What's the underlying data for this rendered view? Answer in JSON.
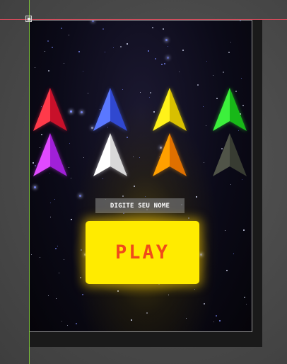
{
  "menu": {
    "name_prompt": "DIGITE SEU NOME",
    "play_label": "PLAY"
  },
  "ships": [
    {
      "name": "red-ship",
      "color": "#ff3a4a",
      "shade": "#c8102a",
      "glow": "#ff2040"
    },
    {
      "name": "blue-ship",
      "color": "#5a78ff",
      "shade": "#3048d0",
      "glow": "#4a66ff"
    },
    {
      "name": "yellow-ship",
      "color": "#fff21a",
      "shade": "#d8c000",
      "glow": "#fff000"
    },
    {
      "name": "green-ship",
      "color": "#3cf03c",
      "shade": "#18b818",
      "glow": "#30ff30"
    },
    {
      "name": "magenta-ship",
      "color": "#e04aff",
      "shade": "#a020d8",
      "glow": "#d030ff"
    },
    {
      "name": "white-ship",
      "color": "#ffffff",
      "shade": "#d8d8d8",
      "glow": "#ffffff"
    },
    {
      "name": "orange-ship",
      "color": "#ffa000",
      "shade": "#e07000",
      "glow": "#ff9000"
    },
    {
      "name": "dark-gray-ship",
      "color": "#505448",
      "shade": "#383c32",
      "glow": "#000000"
    }
  ],
  "colors": {
    "play_button": "#ffeb00",
    "play_text": "#f04a1a",
    "guide_horizontal": "#d24a5a",
    "guide_vertical": "#7cc23a"
  }
}
